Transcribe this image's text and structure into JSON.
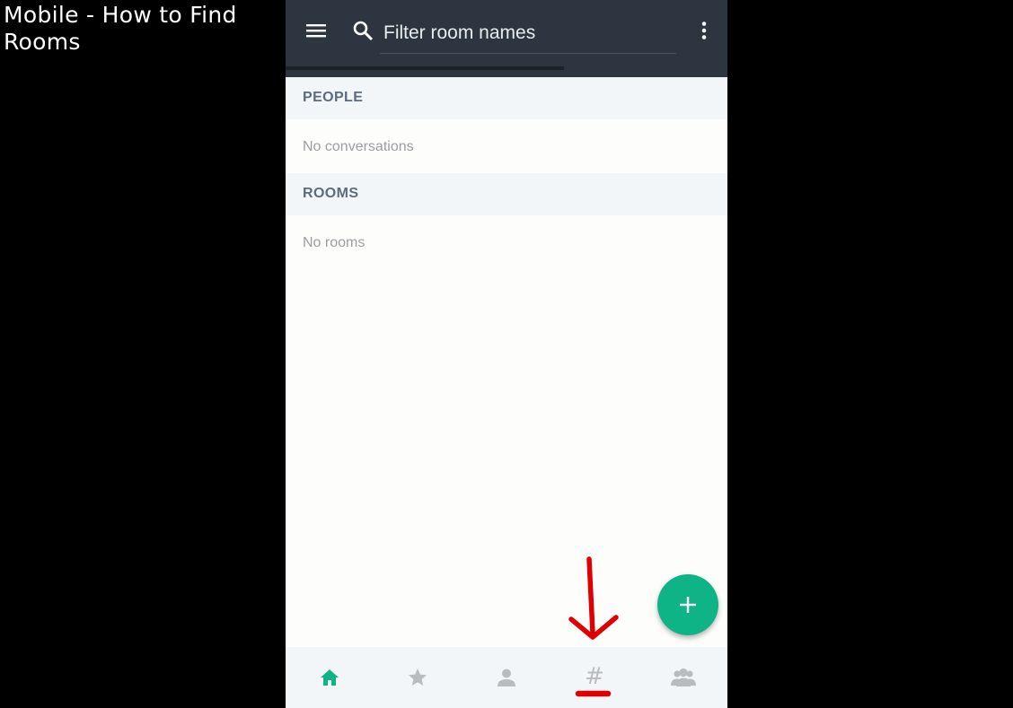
{
  "caption": "Mobile - How to Find Rooms",
  "search": {
    "placeholder": "Filter room names"
  },
  "sections": {
    "people": {
      "header": "PEOPLE",
      "empty": "No conversations"
    },
    "rooms": {
      "header": "ROOMS",
      "empty": "No rooms"
    }
  },
  "bottom_nav": {
    "active": "home",
    "items": [
      {
        "icon": "home-icon"
      },
      {
        "icon": "star-icon"
      },
      {
        "icon": "person-icon"
      },
      {
        "icon": "hash-icon",
        "glyph": "#"
      },
      {
        "icon": "group-icon"
      }
    ]
  },
  "colors": {
    "appbar": "#2d3640",
    "accent": "#0fb486",
    "annotation_arrow": "#e00000",
    "section_bg": "#f2f6f9",
    "inactive_icon": "#b9bcbf"
  }
}
